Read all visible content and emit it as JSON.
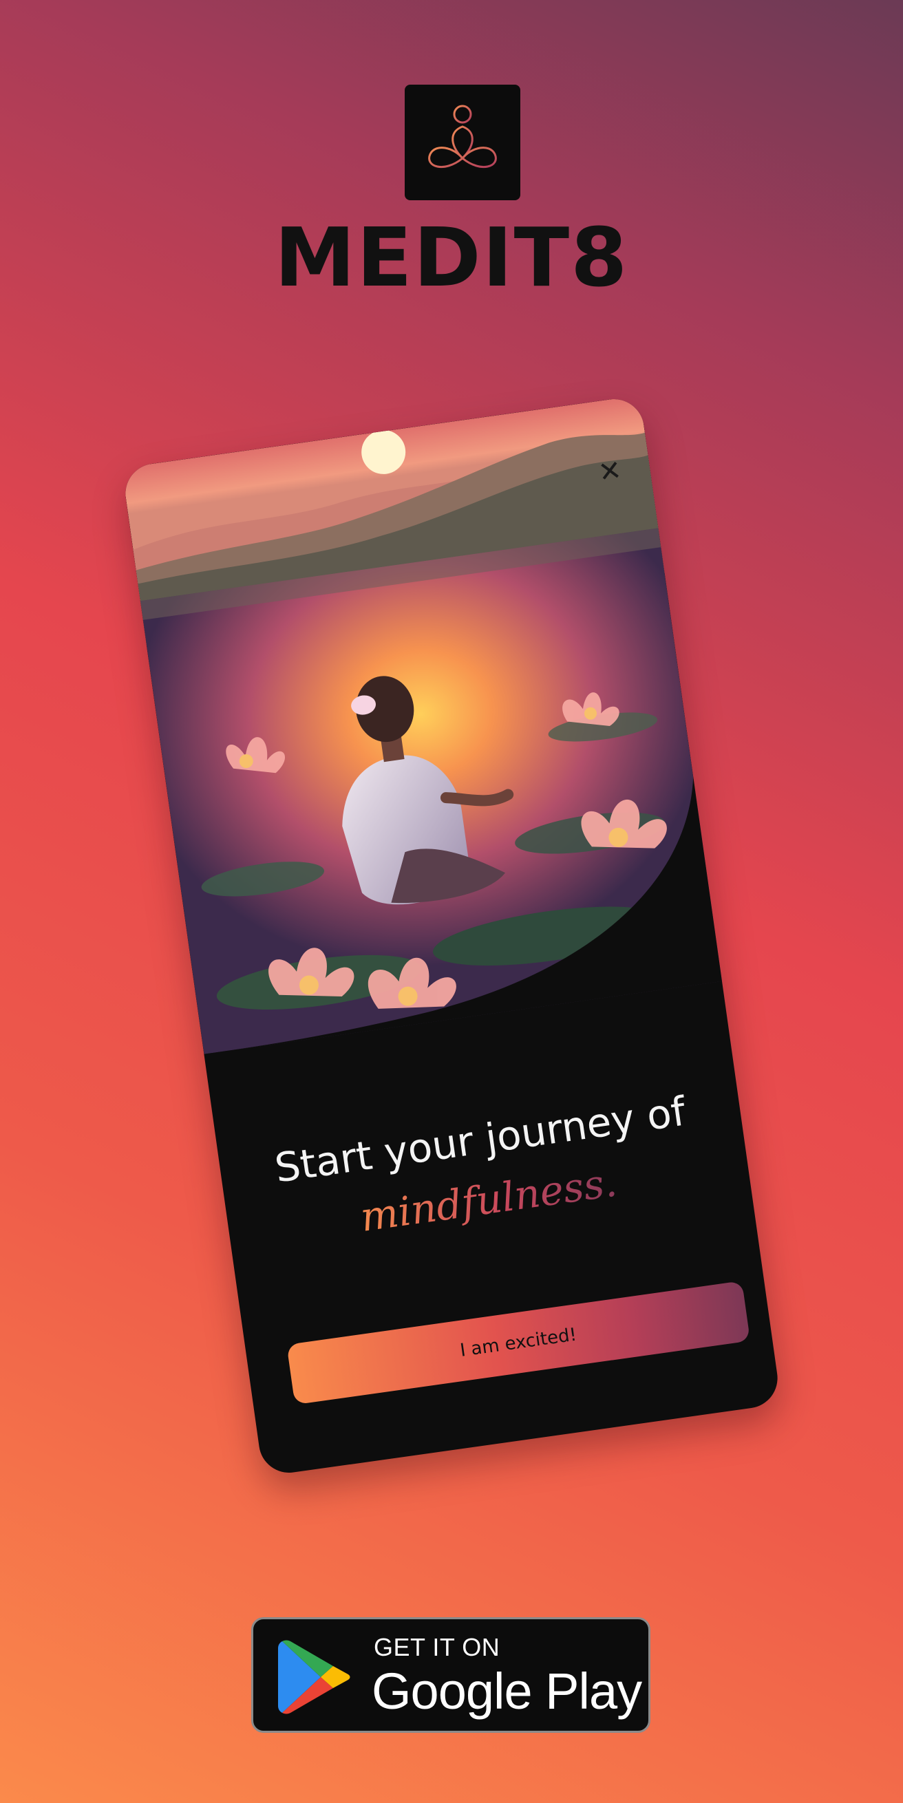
{
  "brand": {
    "name": "MEDIT8",
    "logo_icon": "meditation-infinity-icon",
    "logo_accent_color": "#d0615d"
  },
  "screen": {
    "hero_image": "woman-meditating-lotus-lake-sunset",
    "close_icon": "close-icon",
    "headline": "Start your journey of",
    "headline_accent": "mindfulness.",
    "cta_label": "I am excited!",
    "accent_gradient": [
      "#f98b4c",
      "#e2534e",
      "#7d3856"
    ]
  },
  "store_badge": {
    "small_text": "GET IT ON",
    "big_text": "Google Play",
    "icon": "google-play-icon"
  }
}
